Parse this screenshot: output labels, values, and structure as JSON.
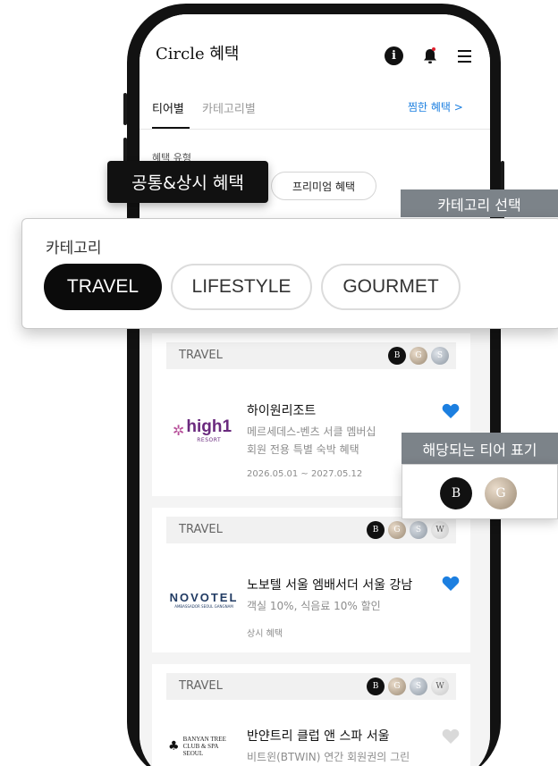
{
  "header": {
    "title": "Circle 혜택",
    "icons": [
      "info-icon",
      "bell-icon",
      "menu-icon"
    ],
    "notification_dot_color": "#e0202e"
  },
  "tabs": [
    {
      "label": "티어별",
      "active": true
    },
    {
      "label": "카테고리별",
      "active": false
    }
  ],
  "favorites_link": "찜한 혜택 >",
  "benefit_type": {
    "label": "혜택 유형",
    "options": [
      "공통&상시 혜택",
      "프리미엄 혜택"
    ],
    "selected": "공통&상시 혜택"
  },
  "category_panel": {
    "callout": "카테고리 선택",
    "title": "카테고리",
    "options": [
      "TRAVEL",
      "LIFESTYLE",
      "GOURMET"
    ],
    "selected": "TRAVEL"
  },
  "tier_callout": {
    "label": "해당되는 티어 표기",
    "tiers": [
      "B",
      "G"
    ]
  },
  "cards": [
    {
      "category": "TRAVEL",
      "tiers": [
        "B",
        "G",
        "S"
      ],
      "logo": {
        "text": "high1",
        "sub": "RESORT",
        "icon": "flower-icon"
      },
      "title": "하이원리조트",
      "desc_lines": [
        "메르세데스-벤츠 서클 멤버십",
        "회원 전용 특별 숙박 혜택"
      ],
      "meta": "2026.05.01 ~ 2027.05.12",
      "favorited": true
    },
    {
      "category": "TRAVEL",
      "tiers": [
        "B",
        "G",
        "S",
        "W"
      ],
      "logo": {
        "text": "NOVOTEL",
        "sub": "AMBASSADOR SEOUL GANGNAM"
      },
      "title": "노보텔 서울 엠배서더 서울 강남",
      "desc_lines": [
        "객실 10%, 식음료 10% 할인"
      ],
      "meta": "상시 혜택",
      "favorited": true
    },
    {
      "category": "TRAVEL",
      "tiers": [
        "B",
        "G",
        "S",
        "W"
      ],
      "logo": {
        "text": "BANYAN TREE",
        "sub": "CLUB & SPA SEOUL",
        "icon": "banyan-tree-icon"
      },
      "title": "반얀트리 클럽 앤 스파 서울",
      "desc_lines": [
        "비트윈(BTWIN) 연간 회원권의 그린"
      ],
      "favorited": false
    }
  ],
  "colors": {
    "accent_blue": "#1c7fe0",
    "heart_off": "#d9d9d9",
    "callout_gray": "#7c8389"
  }
}
